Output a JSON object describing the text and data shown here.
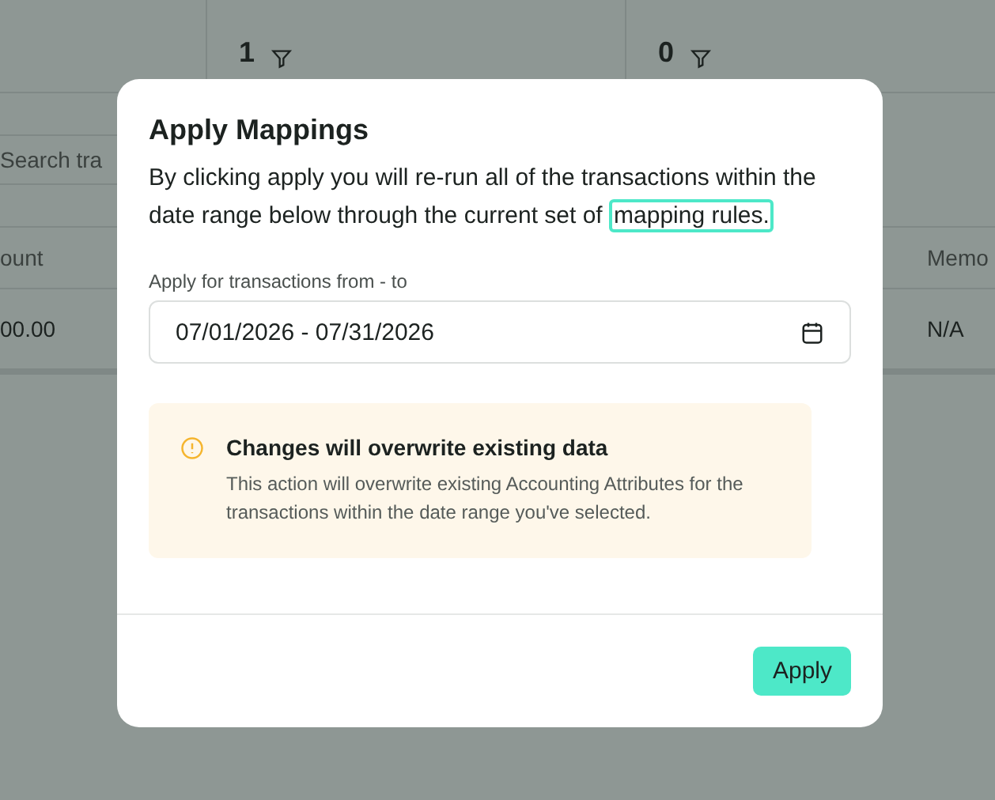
{
  "background": {
    "stats": [
      {
        "value": "1"
      },
      {
        "value": "0"
      }
    ],
    "search": {
      "placeholder": "Search tra"
    },
    "table": {
      "columns": [
        "ount",
        "Memo"
      ],
      "row": [
        "00.00",
        "N/A"
      ]
    }
  },
  "dialog": {
    "title": "Apply Mappings",
    "text_before": "By clicking apply you will re-run all of the transactions within the date range below through the current set of",
    "link": "mapping rules.",
    "field_label": "Apply for transactions from - to",
    "date_range": "07/01/2026 - 07/31/2026",
    "warning": {
      "title": "Changes will overwrite existing data",
      "text": "This action will overwrite existing Accounting Attributes for the transactions within the date range you've selected."
    },
    "button": "Apply"
  }
}
